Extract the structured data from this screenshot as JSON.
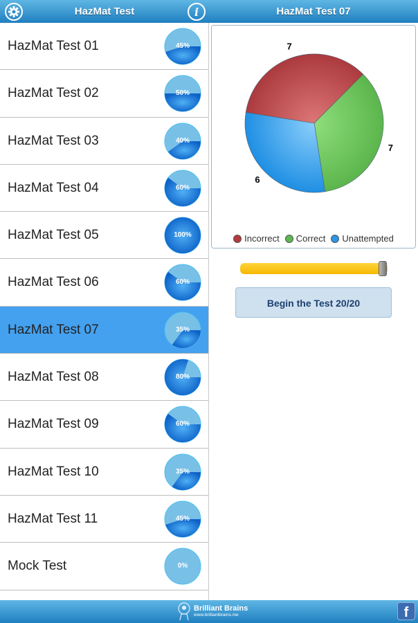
{
  "header": {
    "left_title": "HazMat Test",
    "right_title": "HazMat Test 07",
    "settings_icon": "gear-icon",
    "info_icon": "info-icon",
    "info_glyph": "i"
  },
  "colors": {
    "bar": "#2e8fd0",
    "selected_row": "#44a1ef",
    "incorrect": "#b5393d",
    "correct": "#5cb94f",
    "unattempted": "#2b96e6",
    "pie_done": "#1a78d6",
    "pie_remaining": "#79c0e7"
  },
  "tests": [
    {
      "name": "HazMat Test 01",
      "progress": 45,
      "label": "45%"
    },
    {
      "name": "HazMat Test 02",
      "progress": 50,
      "label": "50%"
    },
    {
      "name": "HazMat Test 03",
      "progress": 40,
      "label": "40%"
    },
    {
      "name": "HazMat Test 04",
      "progress": 60,
      "label": "60%"
    },
    {
      "name": "HazMat Test 05",
      "progress": 100,
      "label": "100%"
    },
    {
      "name": "HazMat Test 06",
      "progress": 60,
      "label": "60%"
    },
    {
      "name": "HazMat Test 07",
      "progress": 35,
      "label": "35%",
      "selected": true
    },
    {
      "name": "HazMat Test 08",
      "progress": 80,
      "label": "80%"
    },
    {
      "name": "HazMat Test 09",
      "progress": 60,
      "label": "60%"
    },
    {
      "name": "HazMat Test 10",
      "progress": 35,
      "label": "35%"
    },
    {
      "name": "HazMat Test 11",
      "progress": 45,
      "label": "45%"
    },
    {
      "name": "Mock Test",
      "progress": 0,
      "label": "0%"
    }
  ],
  "chart_data": {
    "type": "pie",
    "title": "",
    "categories": [
      "Incorrect",
      "Correct",
      "Unattempted"
    ],
    "values": [
      7,
      7,
      6
    ],
    "data_labels": [
      "7",
      "7",
      "6"
    ],
    "legend": "bottom"
  },
  "slider": {
    "value": 20,
    "max": 20
  },
  "begin_button": "Begin the Test 20/20",
  "footer": {
    "brand": "Brilliant Brains",
    "url": "www.brilliantbrains.me",
    "facebook_glyph": "f"
  }
}
